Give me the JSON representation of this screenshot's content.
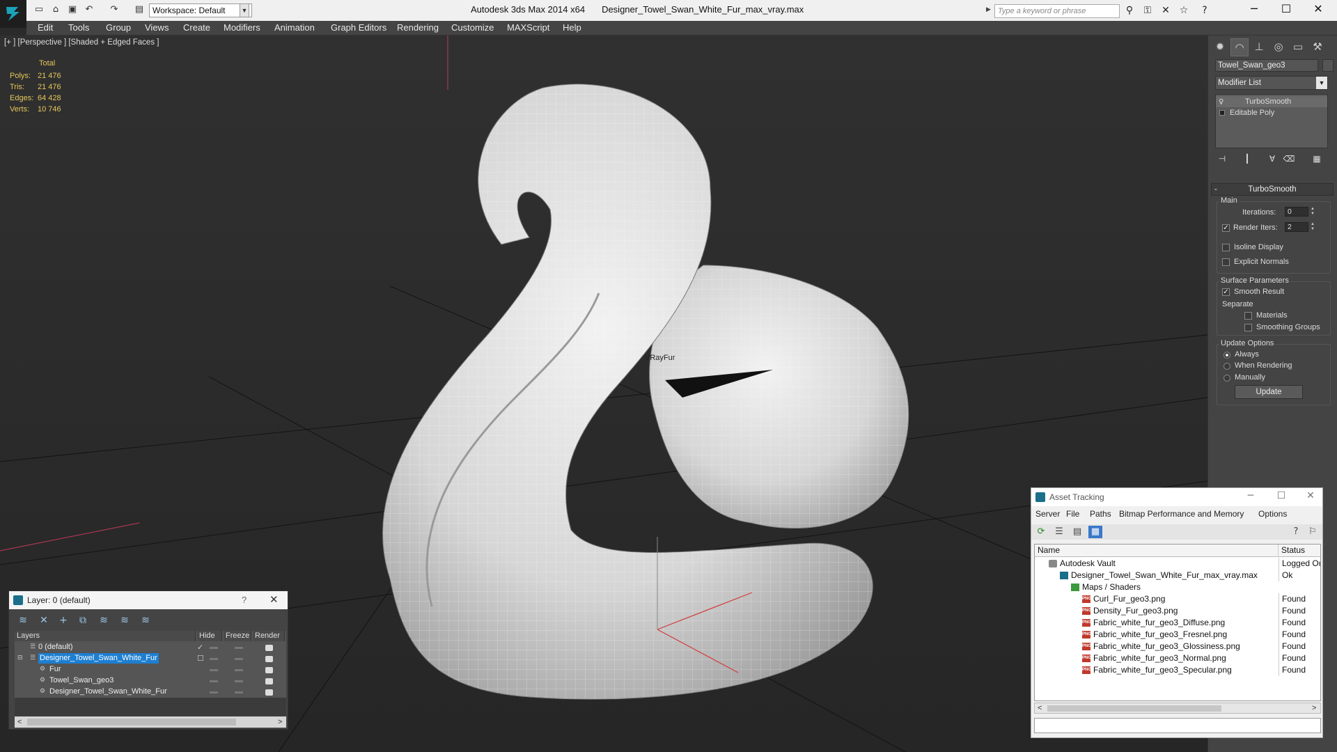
{
  "titlebar": {
    "workspace": "Workspace: Default",
    "app_title": "Autodesk 3ds Max  2014 x64",
    "file_title": "Designer_Towel_Swan_White_Fur_max_vray.max",
    "search_placeholder": "Type a keyword or phrase"
  },
  "menu": [
    "Edit",
    "Tools",
    "Group",
    "Views",
    "Create",
    "Modifiers",
    "Animation",
    "Graph Editors",
    "Rendering",
    "Customize",
    "MAXScript",
    "Help"
  ],
  "viewport": {
    "label": "[+ ] [Perspective ] [Shaded + Edged Faces ]",
    "stats_header": "Total",
    "stats": [
      {
        "key": "Polys:",
        "value": "21 476"
      },
      {
        "key": "Tris:",
        "value": "21 476"
      },
      {
        "key": "Edges:",
        "value": "64 428"
      },
      {
        "key": "Verts:",
        "value": "10 746"
      }
    ],
    "object_label": "VRayFur"
  },
  "command_panel": {
    "object_name": "Towel_Swan_geo3",
    "modifier_list": "Modifier List",
    "stack": [
      "TurboSmooth",
      "Editable Poly"
    ],
    "rollout_title": "TurboSmooth",
    "main_group": "Main",
    "iterations_label": "Iterations:",
    "iterations_value": "0",
    "render_iters_label": "Render Iters:",
    "render_iters_value": "2",
    "isoline_label": "Isoline Display",
    "explicit_normals_label": "Explicit Normals",
    "surface_group": "Surface Parameters",
    "smooth_result_label": "Smooth Result",
    "separate_label": "Separate",
    "materials_label": "Materials",
    "smoothing_groups_label": "Smoothing Groups",
    "update_group": "Update Options",
    "always_label": "Always",
    "when_rendering_label": "When Rendering",
    "manually_label": "Manually",
    "update_button": "Update"
  },
  "layer_dialog": {
    "title": "Layer: 0 (default)",
    "help": "?",
    "columns": {
      "layers": "Layers",
      "hide": "Hide",
      "freeze": "Freeze",
      "render": "Render"
    },
    "rows": [
      {
        "name": "0 (default)"
      },
      {
        "name": "Designer_Towel_Swan_White_Fur"
      },
      {
        "name": "Fur"
      },
      {
        "name": "Towel_Swan_geo3"
      },
      {
        "name": "Designer_Towel_Swan_White_Fur"
      }
    ]
  },
  "asset_dialog": {
    "title": "Asset Tracking",
    "menu": [
      "Server",
      "File",
      "Paths",
      "Bitmap Performance and Memory",
      "Options"
    ],
    "columns": {
      "name": "Name",
      "status": "Status"
    },
    "rows": [
      {
        "name": "Autodesk Vault",
        "status": "Logged Out"
      },
      {
        "name": "Designer_Towel_Swan_White_Fur_max_vray.max",
        "status": "Ok"
      },
      {
        "name": "Maps / Shaders",
        "status": ""
      },
      {
        "name": "Curl_Fur_geo3.png",
        "status": "Found"
      },
      {
        "name": "Density_Fur_geo3.png",
        "status": "Found"
      },
      {
        "name": "Fabric_white_fur_geo3_Diffuse.png",
        "status": "Found"
      },
      {
        "name": "Fabric_white_fur_geo3_Fresnel.png",
        "status": "Found"
      },
      {
        "name": "Fabric_white_fur_geo3_Glossiness.png",
        "status": "Found"
      },
      {
        "name": "Fabric_white_fur_geo3_Normal.png",
        "status": "Found"
      },
      {
        "name": "Fabric_white_fur_geo3_Specular.png",
        "status": "Found"
      }
    ]
  },
  "colors": {
    "viewport_bg": "#2b2b2b",
    "stats_text": "#e6c85a",
    "panel_bg": "#444444",
    "selection": "#1e7fd1"
  }
}
